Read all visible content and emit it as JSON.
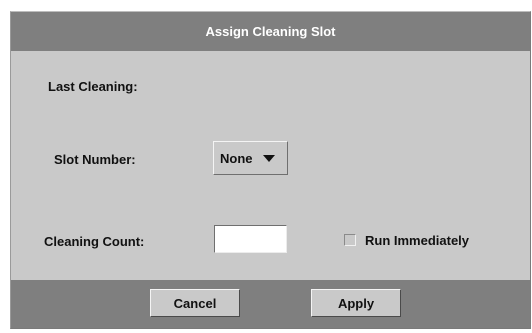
{
  "dialog": {
    "title": "Assign Cleaning Slot",
    "last_cleaning_label": "Last Cleaning:",
    "last_cleaning_value": "",
    "slot_number_label": "Slot Number:",
    "slot_number_value": "None",
    "cleaning_count_label": "Cleaning Count:",
    "cleaning_count_value": "",
    "run_immediately_label": "Run Immediately",
    "run_immediately_checked": false
  },
  "buttons": {
    "cancel": "Cancel",
    "apply": "Apply"
  },
  "colors": {
    "titlebar": "#7f7f7f",
    "panel": "#c9c9c9",
    "title_text": "#ffffff"
  }
}
